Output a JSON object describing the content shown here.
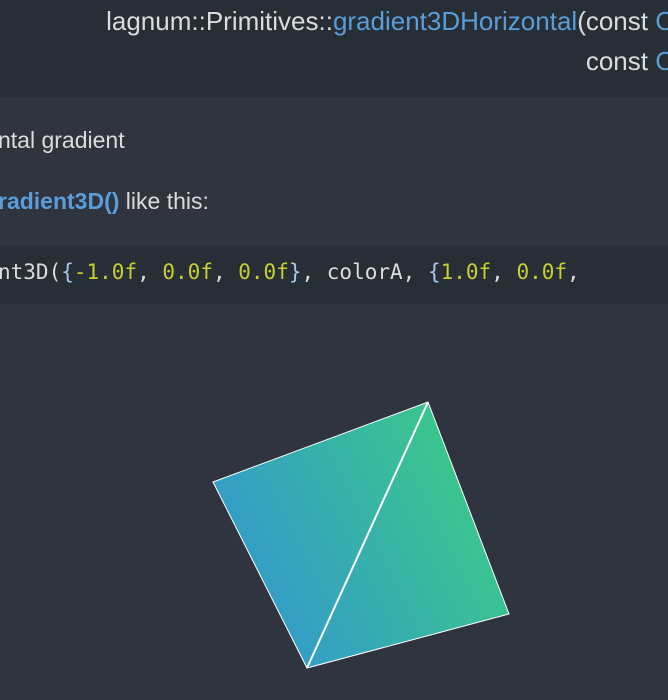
{
  "signature": {
    "line1_prefix": "lagnum::Primitives::",
    "function_name": "gradient3DHorizontal",
    "line1_suffix": "(const ",
    "line1_trail": "C",
    "line2_text": "const ",
    "line2_trail": "C"
  },
  "description": {
    "text": "ntal gradient",
    "link": "radient3D()",
    "after_link": " like this:"
  },
  "code": {
    "fn": "nt3D(",
    "tokens": [
      {
        "t": "{",
        "c": "punct"
      },
      {
        "t": "-1.0f",
        "c": "num"
      },
      {
        "t": ", ",
        "c": "plain"
      },
      {
        "t": "0.0f",
        "c": "num"
      },
      {
        "t": ", ",
        "c": "plain"
      },
      {
        "t": "0.0f",
        "c": "num"
      },
      {
        "t": "}",
        "c": "punct"
      },
      {
        "t": ", colorA, ",
        "c": "plain"
      },
      {
        "t": "{",
        "c": "punct"
      },
      {
        "t": "1.0f",
        "c": "num"
      },
      {
        "t": ", ",
        "c": "plain"
      },
      {
        "t": "0.0f",
        "c": "num"
      },
      {
        "t": ",",
        "c": "plain"
      }
    ]
  },
  "figure": {
    "color_a": "#3399cc",
    "color_b": "#3ccc84",
    "edge_color": "#ffffff"
  }
}
